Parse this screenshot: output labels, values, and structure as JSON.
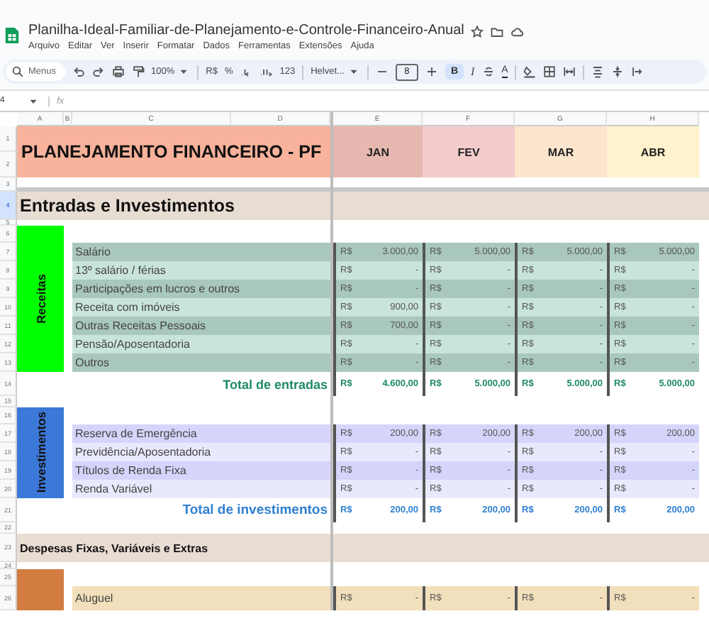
{
  "document": {
    "title": "Planilha-Ideal-Familiar-de-Planejamento-e-Controle-Financeiro-Anual"
  },
  "menus": [
    "Arquivo",
    "Editar",
    "Ver",
    "Inserir",
    "Formatar",
    "Dados",
    "Ferramentas",
    "Extensões",
    "Ajuda"
  ],
  "toolbar": {
    "search_placeholder": "Menus",
    "zoom": "100%",
    "currency": "R$",
    "percent": "%",
    "number_format": "123",
    "font": "Helvet...",
    "font_size": "8",
    "bold": "B",
    "bold_selected": true,
    "italic": "I",
    "text_color": "A"
  },
  "formula_bar": {
    "cell_ref": "4",
    "fx": "fx"
  },
  "columns": [
    "A",
    "B",
    "C",
    "D",
    "E",
    "F",
    "G",
    "H"
  ],
  "rows": [
    {
      "label": "1",
      "selected": false
    },
    {
      "label": "2",
      "selected": false
    },
    {
      "label": "3",
      "selected": false
    },
    {
      "label": "4",
      "selected": true
    },
    {
      "label": "5",
      "selected": false
    },
    {
      "label": "6",
      "selected": false
    },
    {
      "label": "7",
      "selected": false
    },
    {
      "label": "8",
      "selected": false
    },
    {
      "label": "9",
      "selected": false
    },
    {
      "label": "10",
      "selected": false
    },
    {
      "label": "11",
      "selected": false
    },
    {
      "label": "12",
      "selected": false
    },
    {
      "label": "13",
      "selected": false
    },
    {
      "label": "14",
      "selected": false
    },
    {
      "label": "15",
      "selected": false
    },
    {
      "label": "16",
      "selected": false
    },
    {
      "label": "17",
      "selected": false
    },
    {
      "label": "18",
      "selected": false
    },
    {
      "label": "19",
      "selected": false
    },
    {
      "label": "20",
      "selected": false
    },
    {
      "label": "21",
      "selected": false
    },
    {
      "label": "22",
      "selected": false
    },
    {
      "label": "23",
      "selected": false
    },
    {
      "label": "24",
      "selected": false
    },
    {
      "label": "25",
      "selected": false
    },
    {
      "label": "26",
      "selected": false
    }
  ],
  "sheet": {
    "title": "PLANEJAMENTO FINANCEIRO - PF",
    "months": [
      {
        "label": "JAN",
        "color": "#e6b8af"
      },
      {
        "label": "FEV",
        "color": "#f4cccc"
      },
      {
        "label": "MAR",
        "color": "#fce5cd"
      },
      {
        "label": "ABR",
        "color": "#fff2cc"
      }
    ],
    "sections": [
      {
        "kind": "major",
        "heading": "Entradas e Investimentos",
        "groups": [
          {
            "kind": "income",
            "label": "Receitas",
            "color": "#00ff00",
            "items": [
              {
                "name": "Salário",
                "values": [
                  {
                    "unit": "R$",
                    "amount": "3.000,00"
                  },
                  {
                    "unit": "R$",
                    "amount": "5.000,00"
                  },
                  {
                    "unit": "R$",
                    "amount": "5.000,00"
                  },
                  {
                    "unit": "R$",
                    "amount": "5.000,00"
                  }
                ]
              },
              {
                "name": "13º salário / férias",
                "values": [
                  {
                    "unit": "R$",
                    "amount": "-"
                  },
                  {
                    "unit": "R$",
                    "amount": "-"
                  },
                  {
                    "unit": "R$",
                    "amount": "-"
                  },
                  {
                    "unit": "R$",
                    "amount": "-"
                  }
                ]
              },
              {
                "name": "Participações em lucros e outros",
                "values": [
                  {
                    "unit": "R$",
                    "amount": "-"
                  },
                  {
                    "unit": "R$",
                    "amount": "-"
                  },
                  {
                    "unit": "R$",
                    "amount": "-"
                  },
                  {
                    "unit": "R$",
                    "amount": "-"
                  }
                ]
              },
              {
                "name": "Receita com imóveis",
                "values": [
                  {
                    "unit": "R$",
                    "amount": "900,00"
                  },
                  {
                    "unit": "R$",
                    "amount": "-"
                  },
                  {
                    "unit": "R$",
                    "amount": "-"
                  },
                  {
                    "unit": "R$",
                    "amount": "-"
                  }
                ]
              },
              {
                "name": "Outras Receitas Pessoais",
                "values": [
                  {
                    "unit": "R$",
                    "amount": "700,00"
                  },
                  {
                    "unit": "R$",
                    "amount": "-"
                  },
                  {
                    "unit": "R$",
                    "amount": "-"
                  },
                  {
                    "unit": "R$",
                    "amount": "-"
                  }
                ]
              },
              {
                "name": "Pensão/Aposentadoria",
                "values": [
                  {
                    "unit": "R$",
                    "amount": "-"
                  },
                  {
                    "unit": "R$",
                    "amount": "-"
                  },
                  {
                    "unit": "R$",
                    "amount": "-"
                  },
                  {
                    "unit": "R$",
                    "amount": "-"
                  }
                ]
              },
              {
                "name": "Outros",
                "values": [
                  {
                    "unit": "R$",
                    "amount": "-"
                  },
                  {
                    "unit": "R$",
                    "amount": "-"
                  },
                  {
                    "unit": "R$",
                    "amount": "-"
                  },
                  {
                    "unit": "R$",
                    "amount": "-"
                  }
                ]
              }
            ],
            "total": {
              "label": "Total de entradas",
              "values": [
                {
                  "unit": "R$",
                  "amount": "4.600,00"
                },
                {
                  "unit": "R$",
                  "amount": "5.000,00"
                },
                {
                  "unit": "R$",
                  "amount": "5.000,00"
                },
                {
                  "unit": "R$",
                  "amount": "5.000,00"
                }
              ]
            }
          },
          {
            "kind": "investment",
            "label": "Investimentos",
            "color": "#3c78d8",
            "items": [
              {
                "name": "Reserva de Emergência",
                "values": [
                  {
                    "unit": "R$",
                    "amount": "200,00"
                  },
                  {
                    "unit": "R$",
                    "amount": "200,00"
                  },
                  {
                    "unit": "R$",
                    "amount": "200,00"
                  },
                  {
                    "unit": "R$",
                    "amount": "200,00"
                  }
                ]
              },
              {
                "name": "Previdência/Aposentadoria",
                "values": [
                  {
                    "unit": "R$",
                    "amount": "-"
                  },
                  {
                    "unit": "R$",
                    "amount": "-"
                  },
                  {
                    "unit": "R$",
                    "amount": "-"
                  },
                  {
                    "unit": "R$",
                    "amount": "-"
                  }
                ]
              },
              {
                "name": "Títulos de Renda Fixa",
                "values": [
                  {
                    "unit": "R$",
                    "amount": "-"
                  },
                  {
                    "unit": "R$",
                    "amount": "-"
                  },
                  {
                    "unit": "R$",
                    "amount": "-"
                  },
                  {
                    "unit": "R$",
                    "amount": "-"
                  }
                ]
              },
              {
                "name": "Renda Variável",
                "values": [
                  {
                    "unit": "R$",
                    "amount": "-"
                  },
                  {
                    "unit": "R$",
                    "amount": "-"
                  },
                  {
                    "unit": "R$",
                    "amount": "-"
                  },
                  {
                    "unit": "R$",
                    "amount": "-"
                  }
                ]
              }
            ],
            "total": {
              "label": "Total de investimentos",
              "values": [
                {
                  "unit": "R$",
                  "amount": "200,00"
                },
                {
                  "unit": "R$",
                  "amount": "200,00"
                },
                {
                  "unit": "R$",
                  "amount": "200,00"
                },
                {
                  "unit": "R$",
                  "amount": "200,00"
                }
              ]
            }
          }
        ]
      },
      {
        "kind": "minor",
        "heading": "Despesas Fixas, Variáveis e Extras",
        "groups": [
          {
            "kind": "expense",
            "color": "#d27c42",
            "items": [
              {
                "name": "Aluguel",
                "values": [
                  {
                    "unit": "R$",
                    "amount": "-"
                  },
                  {
                    "unit": "R$",
                    "amount": "-"
                  },
                  {
                    "unit": "R$",
                    "amount": "-"
                  },
                  {
                    "unit": "R$",
                    "amount": "-"
                  }
                ]
              }
            ]
          }
        ]
      }
    ]
  }
}
